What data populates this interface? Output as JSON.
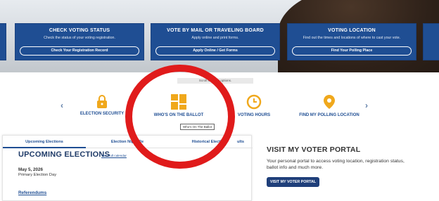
{
  "cards": [
    {
      "title": "CHECK VOTING STATUS",
      "desc": "Check the status of your voting registration.",
      "button": "Check Your Registration Record"
    },
    {
      "title": "VOTE BY MAIL OR TRAVELING BOARD",
      "desc": "Apply online and print forms.",
      "button": "Apply Online / Get Forms"
    },
    {
      "title": "VOTING LOCATION",
      "desc": "Find out the times and locations of where to cast your vote.",
      "button": "Find Your Polling Place"
    }
  ],
  "scroll_tip": "Scroll for more options.",
  "quick_links": [
    {
      "label": "ELECTION SECURITY",
      "icon": "lock-icon"
    },
    {
      "label": "WHO'S ON THE BALLOT",
      "icon": "ballot-grid-icon"
    },
    {
      "label": "VOTING HOURS",
      "icon": "clock-icon"
    },
    {
      "label": "FIND MY POLLING LOCATION",
      "icon": "location-pin-icon"
    }
  ],
  "tooltip": "Who's On The Ballot",
  "tabs": [
    "Upcoming Elections",
    "Election Night Re",
    "Historical Election",
    "ults"
  ],
  "upcoming": {
    "title": "UPCOMING ELECTIONS",
    "full_calendar": "View full calendar",
    "date": "May 5, 2026",
    "event": "Primary Election Day",
    "referendums": "Referendums"
  },
  "portal": {
    "title": "VISIT MY VOTER PORTAL",
    "text": "Your personal portal to access voting location, registration status, ballot info and much more.",
    "button": "VISIT MY VOTER PORTAL"
  },
  "colors": {
    "accent": "#1f4e93",
    "gold": "#f0a81c",
    "highlight_ring": "#e01b1b"
  }
}
